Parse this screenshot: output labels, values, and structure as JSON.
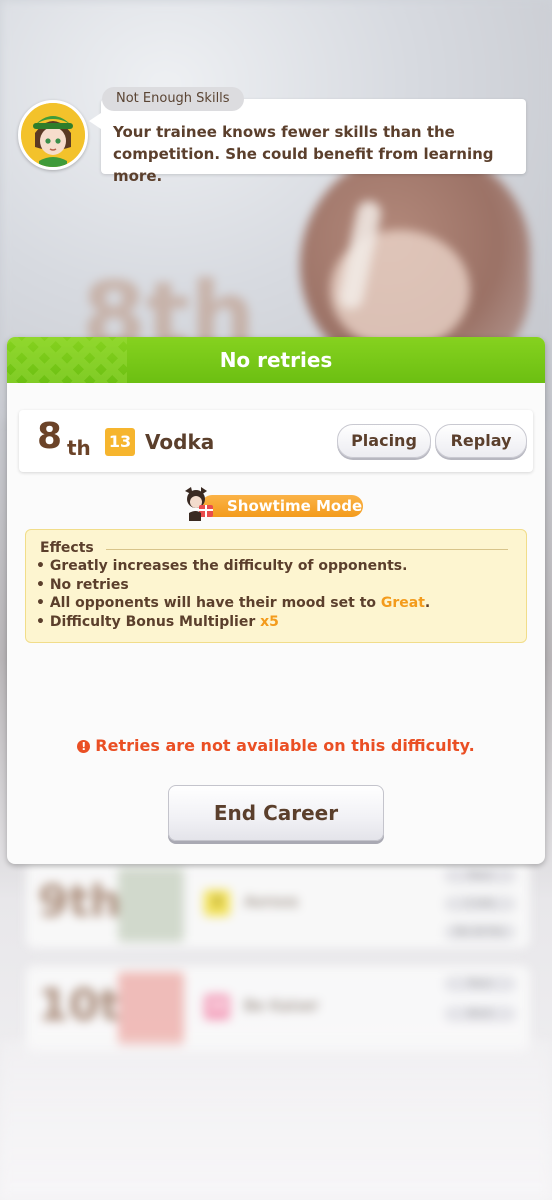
{
  "notice": {
    "tag": "Not Enough Skills",
    "message": "Your trainee knows fewer skills than the competition. She could benefit from learning more.",
    "avatar_icon": "trainer-portrait-icon"
  },
  "dialog": {
    "title": "No retries",
    "result": {
      "place_number": "8",
      "place_suffix": "th",
      "gate": "13",
      "horse_name": "Vodka",
      "placing_label": "Placing",
      "replay_label": "Replay"
    },
    "mode_label": "Showtime Mode",
    "effects": {
      "heading": "Effects",
      "items": [
        "• Greatly increases the difficulty of opponents.",
        "• No retries",
        "• All opponents will have their mood set to ",
        "• Difficulty Bonus Multiplier "
      ],
      "mood_value": "Great",
      "multiplier_value": "x5"
    },
    "warning": "Retries are not available on this difficulty.",
    "end_career_label": "End Career"
  },
  "background": {
    "big_place": "8th",
    "rows": [
      {
        "place": "9th",
        "gate": "3",
        "name": "Aoroos",
        "tags": [
          "Pace",
          "3 3/4L",
          "No.16 Fav"
        ]
      },
      {
        "place": "10th",
        "gate": "16",
        "name": "Be Kaiser",
        "tags": [
          "Pace",
          "Neck"
        ]
      }
    ]
  },
  "colors": {
    "header_green": "#7ccb18",
    "accent_orange": "#f39b1c",
    "warning_red": "#ea4f24",
    "text_brown": "#5b3f2c"
  }
}
